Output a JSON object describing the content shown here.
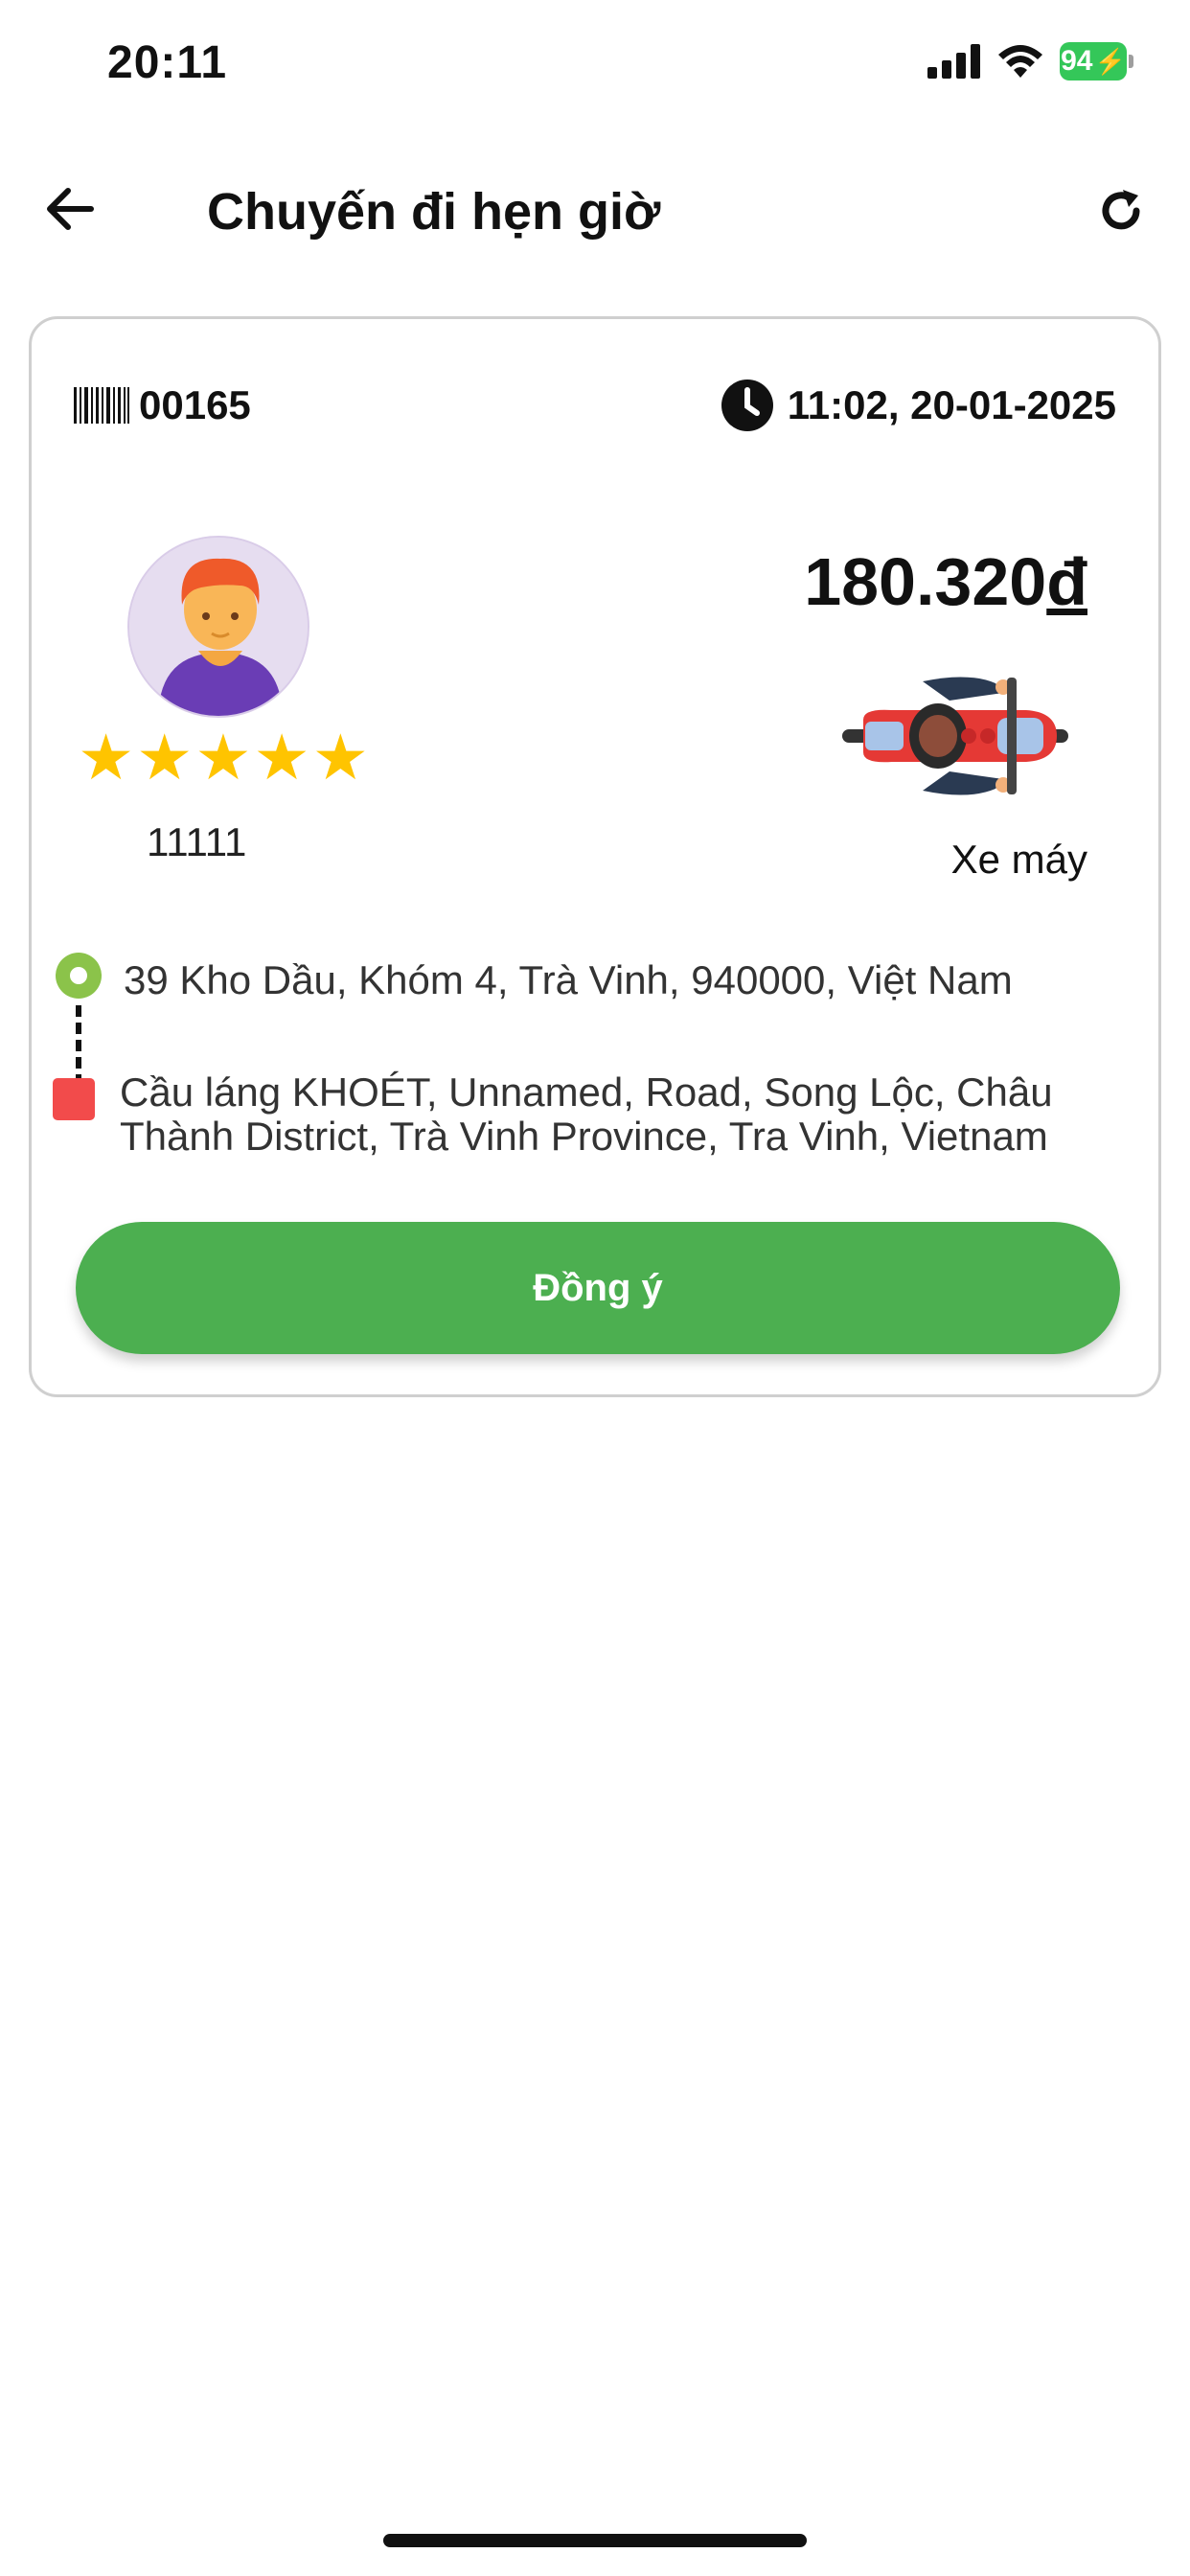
{
  "status_bar": {
    "time": "20:11",
    "battery": "94"
  },
  "header": {
    "title": "Chuyến đi hẹn giờ",
    "back_icon": "arrow-left-icon",
    "refresh_icon": "refresh-icon"
  },
  "trip": {
    "code": "00165",
    "datetime": "11:02, 20-01-2025",
    "price_amount": "180.320",
    "price_currency": "đ",
    "user_id": "11111",
    "rating": 5,
    "vehicle_type": "Xe máy",
    "pickup_address": "39 Kho Dầu, Khóm 4, Trà Vinh, 940000, Việt Nam",
    "dropoff_address": "Cầu láng KHOÉT, Unnamed, Road, Song Lộc, Châu Thành District, Trà Vinh Province, Tra Vinh, Vietnam"
  },
  "actions": {
    "agree_label": "Đồng ý"
  },
  "colors": {
    "primary_green": "#4caf50",
    "pickup_green": "#8bc34a",
    "dropoff_red": "#f24b4b",
    "star_yellow": "#ffc400",
    "battery_green": "#34c759"
  }
}
